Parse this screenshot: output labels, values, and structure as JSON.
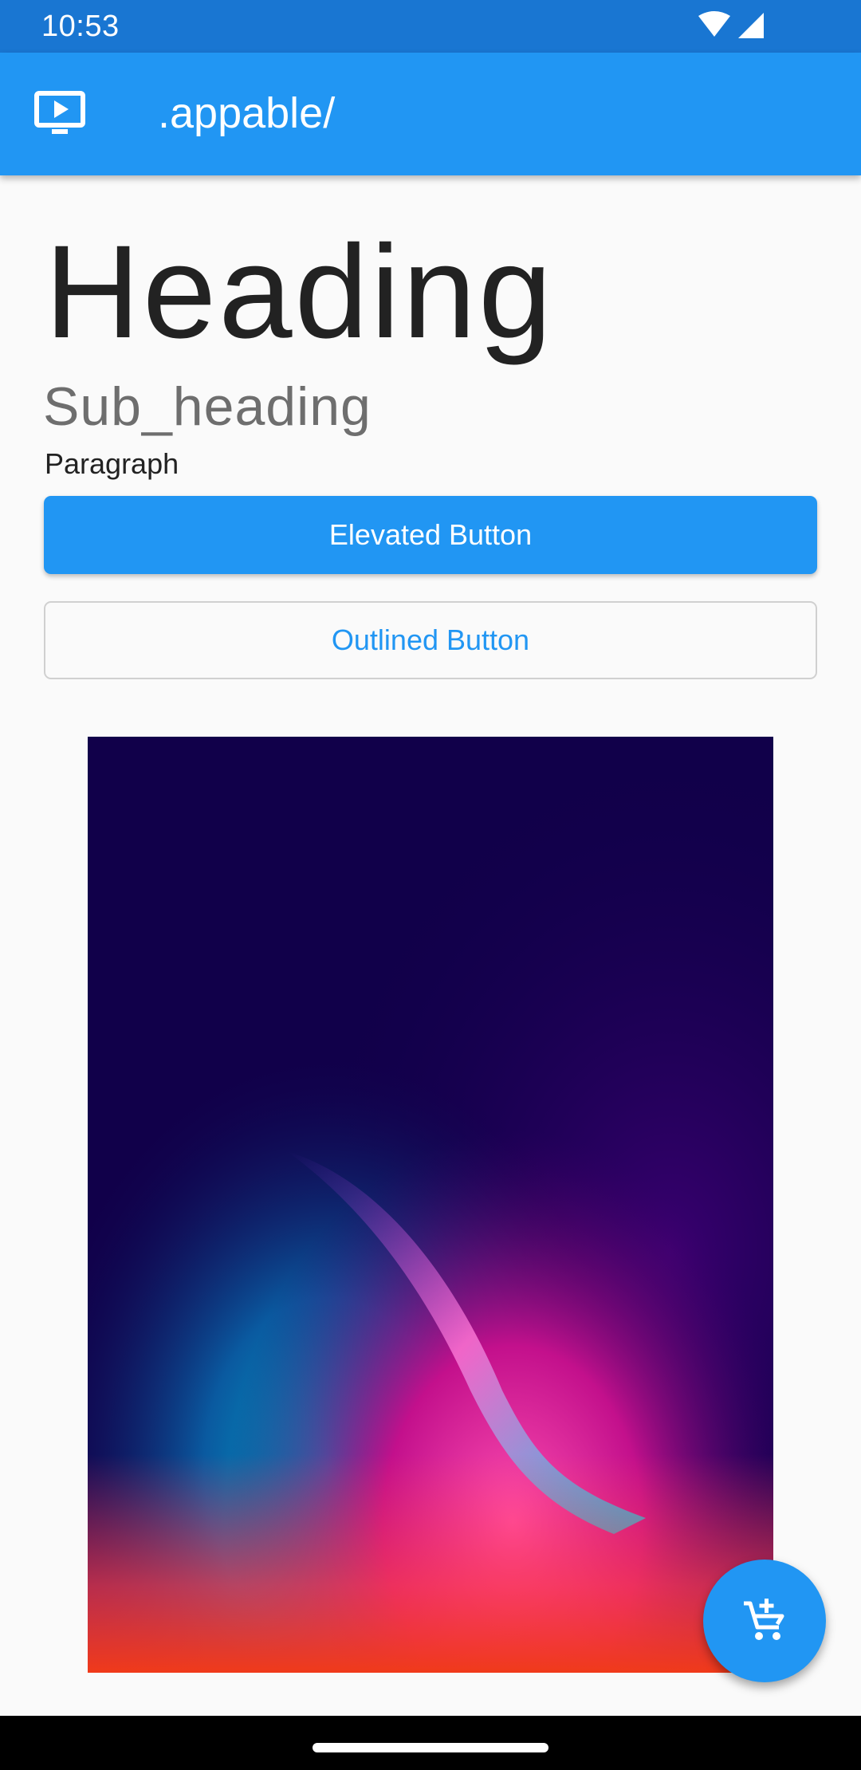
{
  "status_bar": {
    "time": "10:53",
    "icons": [
      "wifi-icon",
      "cellular-signal-icon"
    ]
  },
  "app_bar": {
    "icon": "cast-screen-icon",
    "title": ".appable/",
    "background_color": "#2196f3"
  },
  "content": {
    "heading": "Heading",
    "sub_heading": "Sub_heading",
    "paragraph": "Paragraph",
    "elevated_button_label": "Elevated Button",
    "outlined_button_label": "Outlined Button",
    "image": "abstract-gradient-wallpaper"
  },
  "fab": {
    "icon": "add-shopping-cart-icon",
    "color": "#2196f3"
  },
  "colors": {
    "primary": "#2196f3",
    "status_bar": "#1976d2",
    "background": "#fafafa"
  }
}
